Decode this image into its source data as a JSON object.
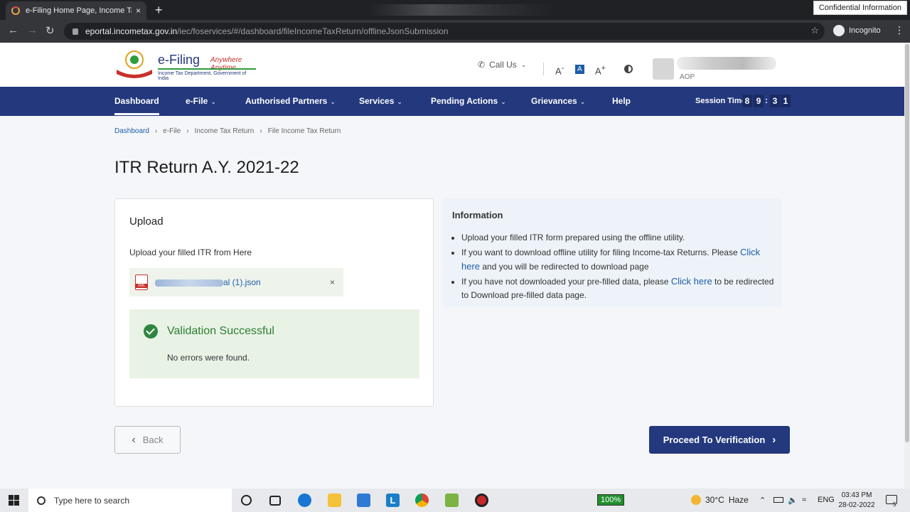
{
  "browser": {
    "tab_title": "e-Filing Home Page, Income Tax",
    "tab_close": "×",
    "new_tab": "+",
    "confidential": "Confidential Information",
    "url_host": "eportal.incometax.gov.in",
    "url_path": "/iec/foservices/#/dashboard/fileIncomeTaxReturn/offlineJsonSubmission",
    "incognito": "Incognito"
  },
  "header": {
    "brand": "e-Filing",
    "tagline": "Anywhere Anytime",
    "dept": "Income Tax Department, Government of India",
    "call_us": "Call Us",
    "font_decrease": "A",
    "font_normal": "A",
    "font_increase": "A",
    "user_role": "AOP"
  },
  "nav": {
    "items": [
      "Dashboard",
      "e-File",
      "Authorised Partners",
      "Services",
      "Pending Actions",
      "Grievances",
      "Help"
    ],
    "session_label": "Session Time",
    "session_digits": [
      "8",
      "9",
      "3",
      "1"
    ],
    "colon": ":"
  },
  "breadcrumb": [
    "Dashboard",
    "e-File",
    "Income Tax Return",
    "File Income Tax Return"
  ],
  "page_title": "ITR Return A.Y. 2021-22",
  "upload": {
    "title": "Upload",
    "subtitle": "Upload your filled ITR from Here",
    "file_suffix": "al (1).json",
    "remove": "×",
    "validation_title": "Validation Successful",
    "validation_msg": "No errors were found."
  },
  "info": {
    "title": "Information",
    "item1": "Upload your filled ITR form prepared using the offline utility.",
    "item2_pre": "If you want to download offline utility for filing Income-tax Returns. Please ",
    "item2_link": "Click here",
    "item2_post": " and you will be redirected to download page",
    "item3_pre": "If you have not downloaded your pre-filled data, please ",
    "item3_link": "Click here",
    "item3_post": " to be redirected to Download pre-filled data page."
  },
  "buttons": {
    "back": "Back",
    "proceed": "Proceed To Verification"
  },
  "taskbar": {
    "search_placeholder": "Type here to search",
    "battery": "100%",
    "temp": "30°C",
    "weather": "Haze",
    "lang": "ENG",
    "time": "03:43 PM",
    "date": "28-02-2022",
    "notif_count": "5"
  }
}
